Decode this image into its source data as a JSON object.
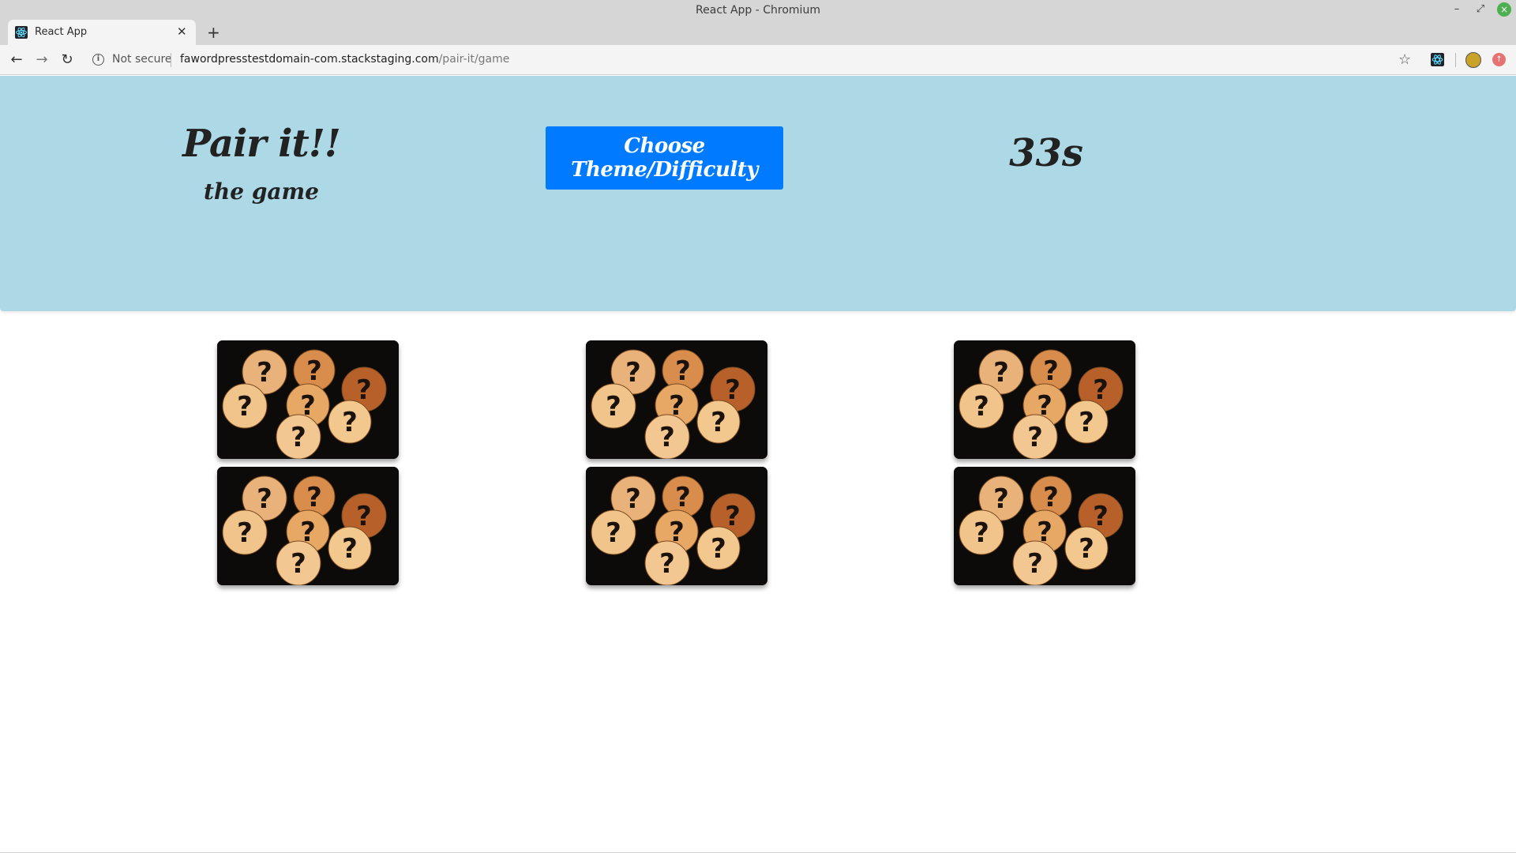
{
  "window": {
    "title": "React App - Chromium"
  },
  "tab": {
    "title": "React App",
    "favicon": "react-logo-icon"
  },
  "toolbar": {
    "security_label": "Not secure",
    "url_host": "fawordpresstestdomain-com.stackstaging.com",
    "url_path": "/pair-it/game"
  },
  "game": {
    "title": "Pair it!!",
    "subtitle": "the game",
    "choose_button": "Choose Theme/Difficulty",
    "timer": "33s",
    "card_back": "question-mark-coins-image",
    "card_count": 6
  },
  "colors": {
    "header_bg": "#add8e6",
    "button_bg": "#007bff",
    "card_bg": "#111111"
  }
}
